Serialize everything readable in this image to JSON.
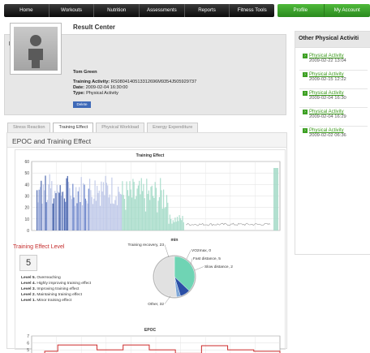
{
  "nav": {
    "items": [
      "Home",
      "Workouts",
      "Nutrition",
      "Assessments",
      "Reports",
      "Fitness Tools"
    ],
    "green_items": [
      "Profile",
      "My Account"
    ]
  },
  "result": {
    "header": "Result Center",
    "title": "Result Center",
    "user_name": "Tom Green",
    "training_activity_label": "Training Activity:",
    "training_activity_value": "RS0804140513312696M9354J505929737",
    "date_label": "Date:",
    "date_value": "2009-02-04 16:30:00",
    "type_label": "Type:",
    "type_value": "Physical Activity",
    "delete_label": "Delete"
  },
  "tabs": [
    "Stress Reaction",
    "Training Effect",
    "Physical Workload",
    "Energy Expenditure"
  ],
  "content": {
    "header": "EPOC and Training Effect",
    "level_title": "Training Effect Level",
    "level_value": "5",
    "levels": [
      {
        "label": "Level 5.",
        "text": "Overreaching"
      },
      {
        "label": "Level 4.",
        "text": "Highly improving training effect"
      },
      {
        "label": "Level 3.",
        "text": "Improving training effect"
      },
      {
        "label": "Level 2.",
        "text": "Maintaining training effect"
      },
      {
        "label": "Level 1.",
        "text": "Minor training effect"
      }
    ]
  },
  "chart_data": [
    {
      "type": "area",
      "title": "Training Effect",
      "y_ticks": [
        "60",
        "50",
        "40",
        "30",
        "20",
        "10",
        "0"
      ],
      "ylim": [
        0,
        60
      ],
      "grid": true
    },
    {
      "type": "pie",
      "title": "min",
      "slices": [
        {
          "label": "Training recovery, 23",
          "value": 23,
          "color": "#6fd4b4"
        },
        {
          "label": "VO2max, 0",
          "value": 0,
          "color": "#2b4fa6"
        },
        {
          "label": "Fast distance, 5",
          "value": 5,
          "color": "#2b4fa6"
        },
        {
          "label": "Slow distance, 2",
          "value": 2,
          "color": "#7fa8d8"
        },
        {
          "label": "Other, 32",
          "value": 32,
          "color": "#e1e1e1"
        }
      ]
    },
    {
      "type": "line",
      "title": "EPOC",
      "y_ticks": [
        "7",
        "6",
        "5",
        "4"
      ],
      "ylim": [
        3.5,
        7
      ],
      "series": [
        {
          "values": [
            3.6,
            4.8,
            5.7,
            5.7,
            5.7,
            5.0,
            5.0,
            5.7,
            5.7,
            5.0,
            5.0,
            4.5,
            4.5,
            5.6,
            5.6,
            5.0,
            5.0,
            4.8,
            4.8,
            4.0
          ]
        }
      ],
      "color": "#cc2a2a",
      "grid": true
    }
  ],
  "side": {
    "header": "Other Physical Activiti",
    "items": [
      {
        "label": "Physical Activity",
        "date": "2009-02-22 13:04"
      },
      {
        "label": "Physical Activity",
        "date": "2009-02-15 12:22"
      },
      {
        "label": "Physical Activity",
        "date": "2009-02-04 16:30"
      },
      {
        "label": "Physical Activity",
        "date": "2009-02-04 16:29"
      },
      {
        "label": "Physical Activity",
        "date": "2009-02-02 06:36"
      }
    ]
  }
}
